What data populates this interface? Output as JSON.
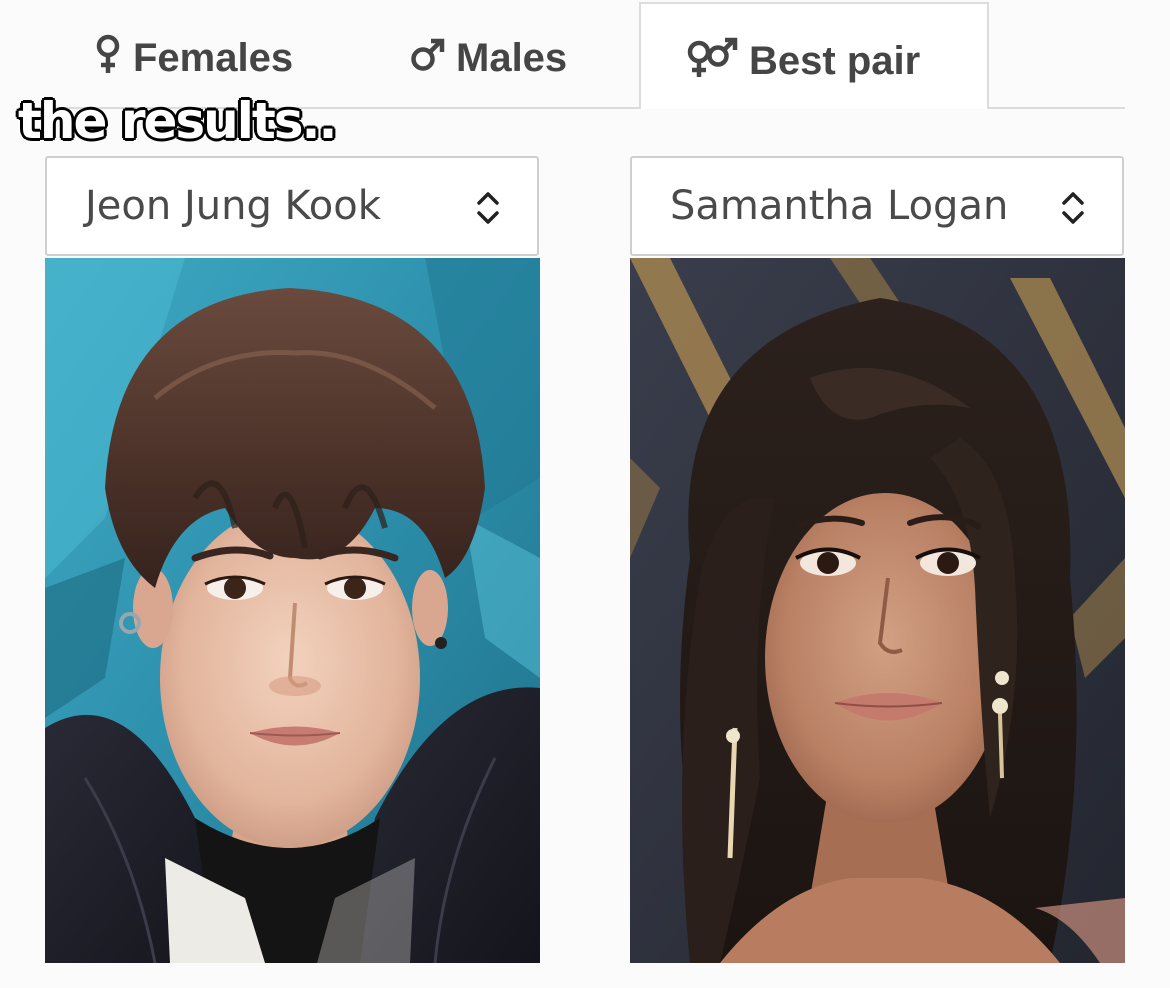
{
  "tabs": {
    "females": {
      "label": "Females",
      "icon": "female-symbol-icon"
    },
    "males": {
      "label": "Males",
      "icon": "male-symbol-icon"
    },
    "best_pair": {
      "label": "Best pair",
      "icon": "pair-symbol-icon",
      "active": true
    }
  },
  "caption": "the results..",
  "pair": {
    "left": {
      "selected": "Jeon Jung Kook",
      "photo": "portrait-photo-male"
    },
    "right": {
      "selected": "Samantha Logan",
      "photo": "portrait-photo-female"
    }
  },
  "colors": {
    "tab_text": "#454545",
    "border": "#dcdcdc",
    "select_text": "#4a4a4a"
  }
}
